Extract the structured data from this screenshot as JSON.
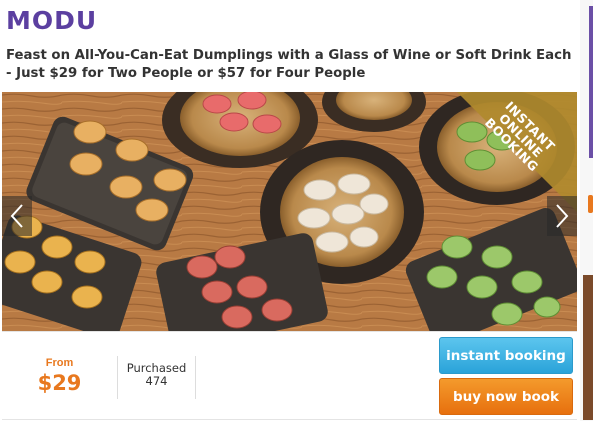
{
  "brand": {
    "name": "MODU",
    "color": "#5b3fa0"
  },
  "deal": {
    "title": "Feast on All-You-Can-Eat Dumplings with a Glass of Wine or Soft Drink Each - Just $29 for Two People or $57 for Four People"
  },
  "hero": {
    "ribbon_lines": [
      "INSTANT",
      "ONLINE",
      "BOOKING"
    ],
    "ribbon_color": "#b08a2e",
    "prev_icon": "chevron-left-icon",
    "next_icon": "chevron-right-icon"
  },
  "pricing": {
    "from_label": "From",
    "price": "$29",
    "purchased_label": "Purchased",
    "purchased_count": "474",
    "accent_color": "#e8781e"
  },
  "actions": {
    "instant_booking_label": "instant booking",
    "buy_later_label": "buy now book later",
    "instant_color": "#2aa3d9",
    "buy_color": "#e7700e"
  }
}
